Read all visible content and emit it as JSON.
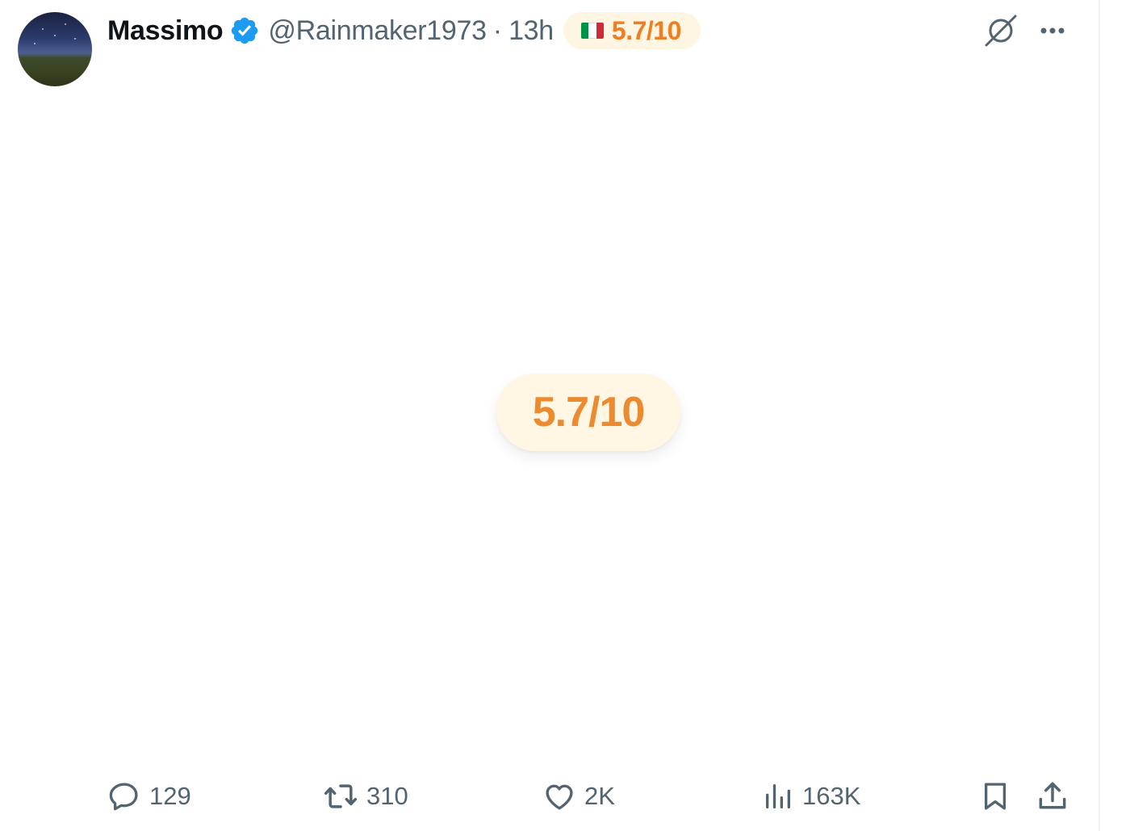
{
  "tweet": {
    "author": {
      "name": "Massimo",
      "handle": "@Rainmaker1973",
      "verified": true,
      "avatar_icon": "avatar-image"
    },
    "separator": "·",
    "time": "13h",
    "rating_badge": {
      "flag": "italy-flag",
      "text": "5.7/10",
      "color": "#f07d1f",
      "background": "#fff5e3"
    },
    "media": {
      "rating_text": "5.7/10",
      "color": "#ec8a2f",
      "background": "#fff6e4"
    },
    "actions": {
      "replies": "129",
      "reposts": "310",
      "likes": "2K",
      "views": "163K"
    },
    "icons": {
      "verified": "verified-badge-icon",
      "grok": "grok-icon",
      "more": "more-icon",
      "reply": "reply-icon",
      "repost": "repost-icon",
      "like": "heart-icon",
      "views": "views-icon",
      "bookmark": "bookmark-icon",
      "share": "share-icon"
    },
    "colors": {
      "verified": "#1d9bf0",
      "muted": "#536471",
      "text": "#0f1419"
    }
  }
}
